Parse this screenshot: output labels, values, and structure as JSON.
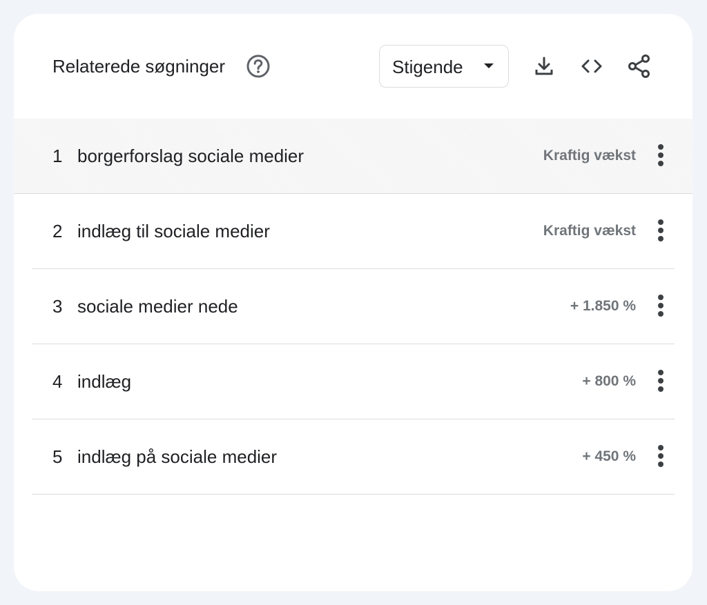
{
  "header": {
    "title": "Relaterede søgninger",
    "help_icon": "help-circle-icon",
    "sort": {
      "selected": "Stigende"
    },
    "tools": [
      "download-icon",
      "code-icon",
      "share-icon"
    ]
  },
  "rows": [
    {
      "rank": "1",
      "query": "borgerforslag sociale medier",
      "value": "Kraftig vækst"
    },
    {
      "rank": "2",
      "query": "indlæg til sociale medier",
      "value": "Kraftig vækst"
    },
    {
      "rank": "3",
      "query": "sociale medier nede",
      "value": "+ 1.850 %"
    },
    {
      "rank": "4",
      "query": "indlæg",
      "value": "+ 800 %"
    },
    {
      "rank": "5",
      "query": "indlæg på sociale medier",
      "value": "+ 450 %"
    }
  ],
  "colors": {
    "background": "#f1f4f9",
    "card": "#ffffff",
    "text": "#202124",
    "muted": "#70757a",
    "divider": "#dadce0"
  }
}
